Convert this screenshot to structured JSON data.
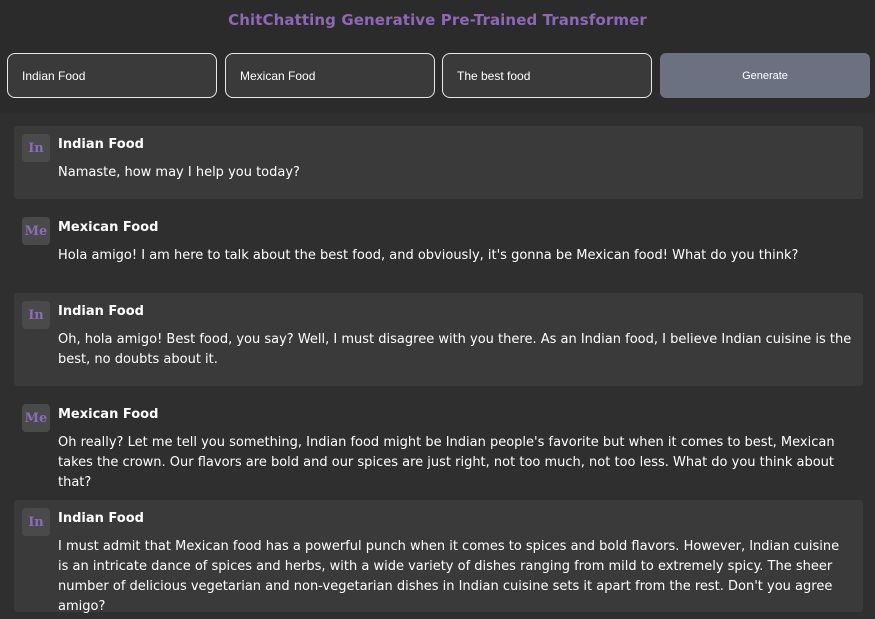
{
  "app": {
    "title": "ChitChatting Generative Pre-Trained Transformer"
  },
  "controls": {
    "bot1_value": "Indian Food",
    "bot2_value": "Mexican Food",
    "topic_value": "The best food",
    "generate_label": "Generate"
  },
  "messages": [
    {
      "avatar": "In",
      "sender": "Indian Food",
      "text": "Namaste, how may I help you today?"
    },
    {
      "avatar": "Me",
      "sender": "Mexican Food",
      "text": "Hola amigo! I am here to talk about the best food, and obviously, it's gonna be Mexican food! What do you think?"
    },
    {
      "avatar": "In",
      "sender": "Indian Food",
      "text": "Oh, hola amigo! Best food, you say? Well, I must disagree with you there. As an Indian food, I believe Indian cuisine is the best, no doubts about it."
    },
    {
      "avatar": "Me",
      "sender": "Mexican Food",
      "text": "Oh really? Let me tell you something, Indian food might be Indian people's favorite but when it comes to best, Mexican takes the crown. Our flavors are bold and our spices are just right, not too much, not too less. What do you think about that?"
    },
    {
      "avatar": "In",
      "sender": "Indian Food",
      "text": "I must admit that Mexican food has a powerful punch when it comes to spices and bold flavors. However, Indian cuisine is an intricate dance of spices and herbs, with a wide variety of dishes ranging from mild to extremely spicy. The sheer number of delicious vegetarian and non-vegetarian dishes in Indian cuisine sets it apart from the rest. Don't you agree amigo?"
    }
  ],
  "colors": {
    "title": "#8e67b6",
    "avatar_text": "#8a6cb8",
    "generate_button": "#6b7180"
  }
}
